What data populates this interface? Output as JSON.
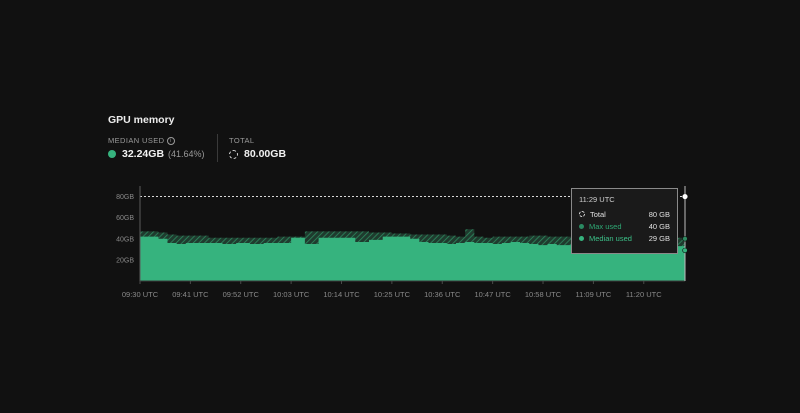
{
  "title": "GPU memory",
  "stats": {
    "median_label": "MEDIAN USED",
    "median_value": "32.24GB",
    "median_pct": "(41.64%)",
    "total_label": "TOTAL",
    "total_value": "80.00GB"
  },
  "colors": {
    "median": "#36b37e",
    "max_hatch": "#2a7a58",
    "background": "#111111",
    "total_line": "#d8d8d8"
  },
  "tooltip": {
    "time": "11:29 UTC",
    "rows": [
      {
        "label": "Total",
        "value": "80 GB"
      },
      {
        "label": "Max used",
        "value": "40 GB"
      },
      {
        "label": "Median used",
        "value": "29 GB"
      }
    ]
  },
  "chart_data": {
    "type": "area",
    "y_ticks": [
      "20GB",
      "40GB",
      "60GB",
      "80GB"
    ],
    "y_tick_values": [
      20,
      40,
      60,
      80
    ],
    "ylim": [
      0,
      90
    ],
    "x_tick_labels": [
      "09:30 UTC",
      "09:41 UTC",
      "09:52 UTC",
      "10:03 UTC",
      "10:14 UTC",
      "10:25 UTC",
      "10:36 UTC",
      "10:47 UTC",
      "10:58 UTC",
      "11:09 UTC",
      "11:20 UTC"
    ],
    "x_minutes": [
      0,
      4,
      6,
      8,
      10,
      12,
      15,
      18,
      21,
      24,
      27,
      30,
      33,
      36,
      39,
      41,
      43,
      45,
      47,
      50,
      53,
      55,
      57,
      59,
      61,
      63,
      65,
      67,
      69,
      71,
      73,
      75,
      77,
      79,
      81,
      83,
      85,
      87,
      89,
      91,
      93,
      95,
      97,
      99,
      101,
      103,
      105,
      107,
      109,
      111,
      113,
      115,
      117,
      119
    ],
    "series": [
      {
        "name": "Total",
        "values": [
          80,
          80,
          80,
          80,
          80,
          80,
          80,
          80,
          80,
          80,
          80,
          80,
          80,
          80,
          80,
          80,
          80,
          80,
          80,
          80,
          80,
          80,
          80,
          80,
          80,
          80,
          80,
          80,
          80,
          80,
          80,
          80,
          80,
          80,
          80,
          80,
          80,
          80,
          80,
          80,
          80,
          80,
          80,
          80,
          80,
          80,
          80,
          80,
          80,
          80,
          80,
          80,
          80,
          80
        ]
      },
      {
        "name": "Max used",
        "values": [
          47,
          46,
          44,
          43,
          43,
          43,
          41,
          41,
          41,
          41,
          41,
          42,
          42,
          47,
          47,
          47,
          47,
          47,
          47,
          46,
          46,
          45,
          45,
          44,
          44,
          44,
          44,
          43,
          42,
          49,
          42,
          41,
          42,
          42,
          42,
          42,
          43,
          43,
          42,
          42,
          42,
          42,
          42,
          41,
          42,
          42,
          42,
          42,
          42,
          42,
          42,
          41,
          41,
          40
        ]
      },
      {
        "name": "Median used",
        "values": [
          42,
          40,
          36,
          35,
          36,
          36,
          36,
          35,
          36,
          35,
          36,
          36,
          41,
          35,
          41,
          41,
          41,
          41,
          37,
          39,
          42,
          42,
          42,
          40,
          37,
          36,
          36,
          35,
          36,
          37,
          36,
          36,
          35,
          36,
          37,
          36,
          35,
          34,
          35,
          34,
          34,
          35,
          35,
          35,
          35,
          35,
          35,
          35,
          34,
          34,
          34,
          33,
          33,
          29
        ]
      }
    ],
    "hover_minute": 119
  }
}
